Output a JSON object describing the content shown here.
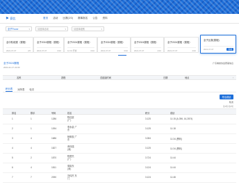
{
  "colors": {
    "accent": "#1e6fd9",
    "banner": "#1e6fd9"
  },
  "nav": {
    "logo_icon": "logo-icon",
    "logo_text": "赛比",
    "items": [
      "首页",
      "活动",
      "比赛(2/3)",
      "赛事报名",
      "公告",
      "资料"
    ],
    "active_index": 0
  },
  "filters": {
    "province": "全子Pouse",
    "event": "请选择活动",
    "group": "请选择组别"
  },
  "cards": [
    {
      "title": "全中阶段赛（赛程）",
      "left": "2021-07-07",
      "right": "2/6"
    },
    {
      "title": "全子2024赛程（赛程）",
      "left": "2021-07-07",
      "right": "0/10"
    },
    {
      "title": "全子2024赛程（赛程）",
      "left": "12:01 开赛",
      "right": "0/10"
    },
    {
      "title": "全子2024赛程（赛程）",
      "left": "2021-07-07",
      "right": "0/10"
    },
    {
      "title": "全子2024赛程（赛程）",
      "left": "2021-07-07",
      "right": "2/10"
    },
    {
      "title": "全子2024赛程（赛程）",
      "left": "2021-07-07",
      "right": "2/10"
    },
    {
      "title": "全子比赛(赛程)",
      "left": "2021-07-07",
      "right": "完成"
    }
  ],
  "section": {
    "title": "全子2024赛程",
    "date": "2024-11-17 21:00",
    "right_link": "广东棋类协会赛事信息"
  },
  "info_table": {
    "headers": [
      "名称",
      "赛程",
      "总起始时间",
      "日期",
      "地点"
    ]
  },
  "subtabs": {
    "items": [
      "积分表",
      "对阵表",
      "轮次"
    ],
    "active_index": 0
  },
  "actions": {
    "button": "导出成绩",
    "note1": "轮次",
    "note2": "第2轮/第2轮"
  },
  "grid": {
    "headers": [
      "排名",
      "棋手",
      "号码",
      "姓名",
      "积分",
      "成绩"
    ],
    "rows": [
      {
        "rank": "1",
        "player": "1",
        "number": "1286",
        "name": "陈佳豪 (广)",
        "score": "3.125",
        "result": "11:15 (A,396, 16,2874)"
      },
      {
        "rank": "2",
        "player": "1",
        "number": "1094",
        "name": "李永豪 广东",
        "score": "3.125",
        "result": "11:18"
      },
      {
        "rank": "3",
        "player": "4",
        "number": "1686",
        "name": "杨明权 广东",
        "score": "3.284",
        "result": "11:34 (黑利)"
      },
      {
        "rank": "4",
        "player": "4",
        "number": "1827",
        "name": "黄伟强 (深)",
        "score": "3.125",
        "result": "11:34 (黑利)"
      },
      {
        "rank": "5",
        "player": "2",
        "number": "1870",
        "name": "陈楚杰 (广)",
        "score": "3.724",
        "result": "11:44"
      },
      {
        "rank": "6",
        "player": "4",
        "number": "1811",
        "name": "周晓东 (深)",
        "score": "3.124",
        "result": "11:44"
      },
      {
        "rank": "7",
        "player": "7",
        "number": "2090",
        "name": "刘伟杰 东门",
        "score": "3.124",
        "result": "11:48"
      }
    ]
  }
}
